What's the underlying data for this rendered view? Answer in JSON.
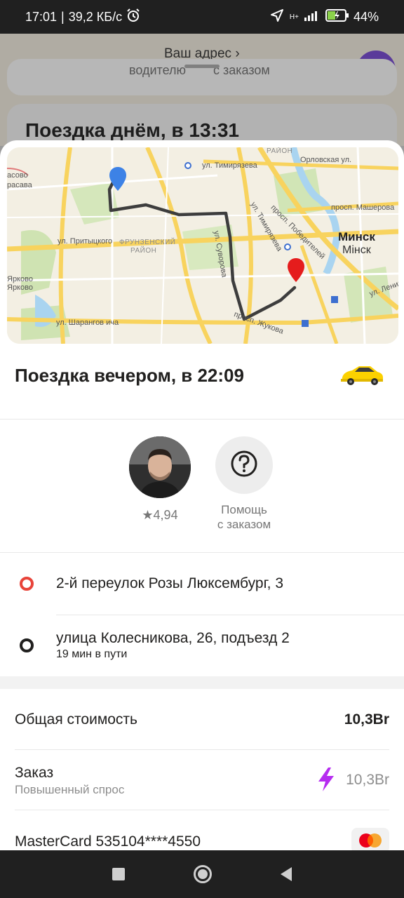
{
  "status_bar": {
    "time": "17:01",
    "speed": "39,2 КБ/с",
    "network": "H+",
    "battery": "44%"
  },
  "background": {
    "address_title": "Ваш адрес",
    "card_driver": "водителю",
    "card_order": "с заказом",
    "card_trip_title": "Поездка днём, в 13:31"
  },
  "map": {
    "labels": {
      "district_top": "РАЙОН",
      "street_timiryazeva": "ул. Тимирязева",
      "street_orlovskaya": "Орловская ул.",
      "left_1": "асово",
      "left_2": "расава",
      "prosp_pobediteley": "просп. Победителей",
      "prosp_masherova": "просп. Машерова",
      "street_timiryazeva_2": "ул. Тимирязева",
      "street_pritytskogo": "ул. Притыцкого",
      "frunzensky": "ФРУНЗЕНСКИЙ",
      "rayon": "РАЙОН",
      "city_ru": "Минск",
      "city_by": "Мінск",
      "yarkovo_1": "Ярково",
      "yarkovo_2": "Ярково",
      "street_sharangovicha": "ул. Шарангов ича",
      "prosp_zhukova": "просп. Жукова",
      "street_lenina": "ул. Ленина",
      "route_label": "ул. Суворова"
    }
  },
  "trip": {
    "title": "Поездка вечером, в 22:09"
  },
  "driver": {
    "rating": "4,94"
  },
  "help": {
    "label_line1": "Помощь",
    "label_line2": "с заказом"
  },
  "route": {
    "from": "2-й переулок Розы Люксембург, 3",
    "to": "улица Колесникова, 26, подъезд 2",
    "duration": "19 мин в пути"
  },
  "price": {
    "total_label": "Общая стоимость",
    "total_value": "10,3Br",
    "order_label": "Заказ",
    "order_sub": "Повышенный спрос",
    "order_value": "10,3Br",
    "card_label": "MasterCard 535104****4550"
  },
  "colors": {
    "accent_red": "#e8443a",
    "surge_purple": "#b62cf0",
    "taxi_yellow": "#fcd100",
    "pin_blue": "#3d82e6",
    "pin_red": "#e51c1c"
  }
}
